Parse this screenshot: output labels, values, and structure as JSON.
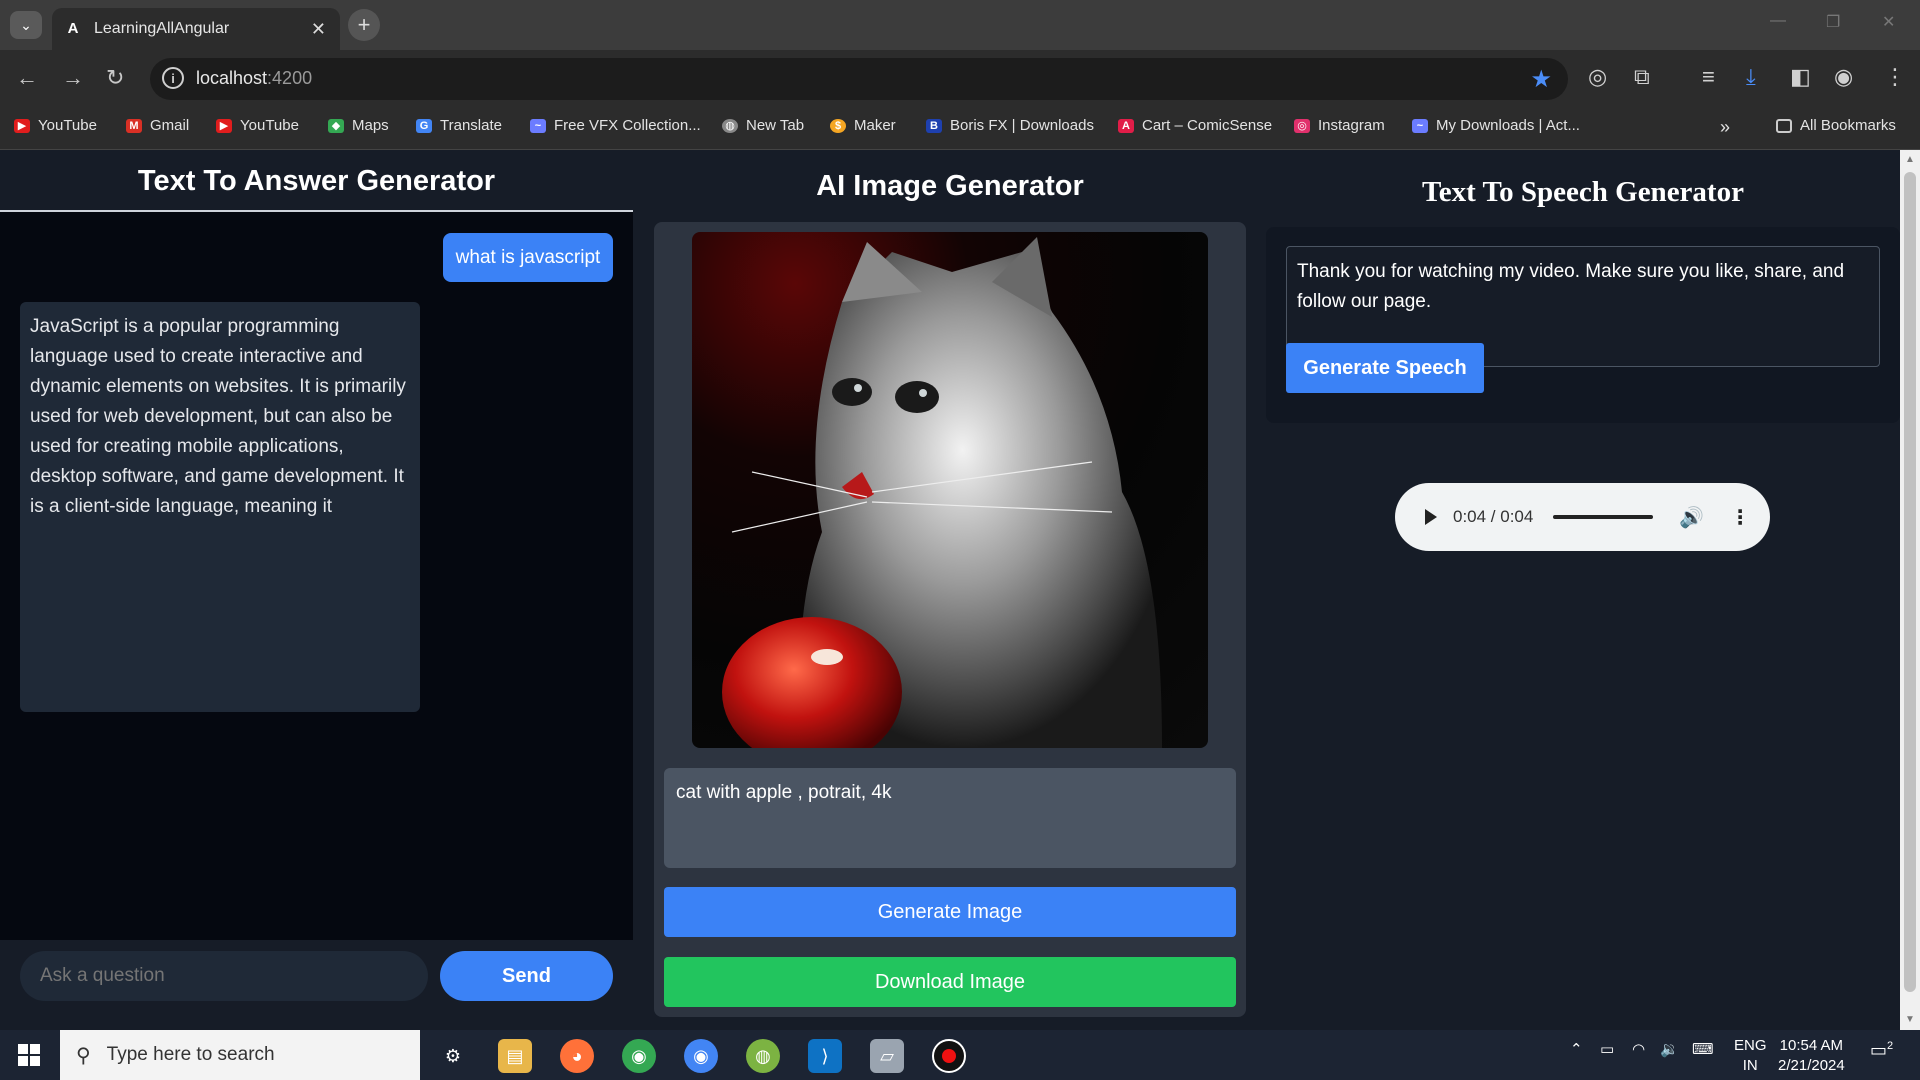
{
  "browser": {
    "tab_title": "LearningAllAngular",
    "tab_favicon": "A",
    "url_host": "localhost",
    "url_port": ":4200",
    "bookmarks": [
      {
        "label": "YouTube",
        "icon": "youtube-icon",
        "color": "#e11d1d"
      },
      {
        "label": "Gmail",
        "icon": "gmail-icon",
        "color": "#d93025"
      },
      {
        "label": "YouTube",
        "icon": "youtube-icon",
        "color": "#e11d1d"
      },
      {
        "label": "Maps",
        "icon": "maps-icon",
        "color": "#34a853"
      },
      {
        "label": "Translate",
        "icon": "translate-icon",
        "color": "#4285f4"
      },
      {
        "label": "Free VFX Collection...",
        "icon": "vfx-icon",
        "color": "#6b7cff"
      },
      {
        "label": "New Tab",
        "icon": "globe-icon",
        "color": "#888888"
      },
      {
        "label": "Maker",
        "icon": "maker-icon",
        "color": "#f5a623"
      },
      {
        "label": "Boris FX | Downloads",
        "icon": "borisfx-icon",
        "color": "#1e40af"
      },
      {
        "label": "Cart – ComicSense",
        "icon": "comicsense-icon",
        "color": "#e11d48"
      },
      {
        "label": "Instagram",
        "icon": "instagram-icon",
        "color": "#e1306c"
      },
      {
        "label": "My Downloads | Act...",
        "icon": "downloads-icon",
        "color": "#6b7cff"
      }
    ],
    "all_bookmarks": "All Bookmarks"
  },
  "chat": {
    "title": "Text To Answer Generator",
    "user_message": "what is javascript",
    "bot_message": "JavaScript is a popular programming language used to create interactive and dynamic elements on websites. It is primarily used for web development, but can also be used for creating mobile applications, desktop software, and game development. It is a client-side language, meaning it",
    "input_placeholder": "Ask a question",
    "send_label": "Send"
  },
  "image_gen": {
    "title": "AI Image Generator",
    "prompt": "cat with apple , potrait, 4k",
    "generate_label": "Generate Image",
    "download_label": "Download Image"
  },
  "speech": {
    "title": "Text To Speech Generator",
    "text": "Thank you for watching my video. Make sure you like, share, and follow our page.",
    "generate_label": "Generate Speech",
    "audio_time": "0:04 / 0:04",
    "audio_progress": 1.0
  },
  "taskbar": {
    "search_placeholder": "Type here to search",
    "lang_top": "ENG",
    "lang_bottom": "IN",
    "time": "10:54 AM",
    "date": "2/21/2024",
    "notification_count": "2"
  },
  "colors": {
    "accent_blue": "#3b82f6",
    "download_green": "#22c55e"
  }
}
